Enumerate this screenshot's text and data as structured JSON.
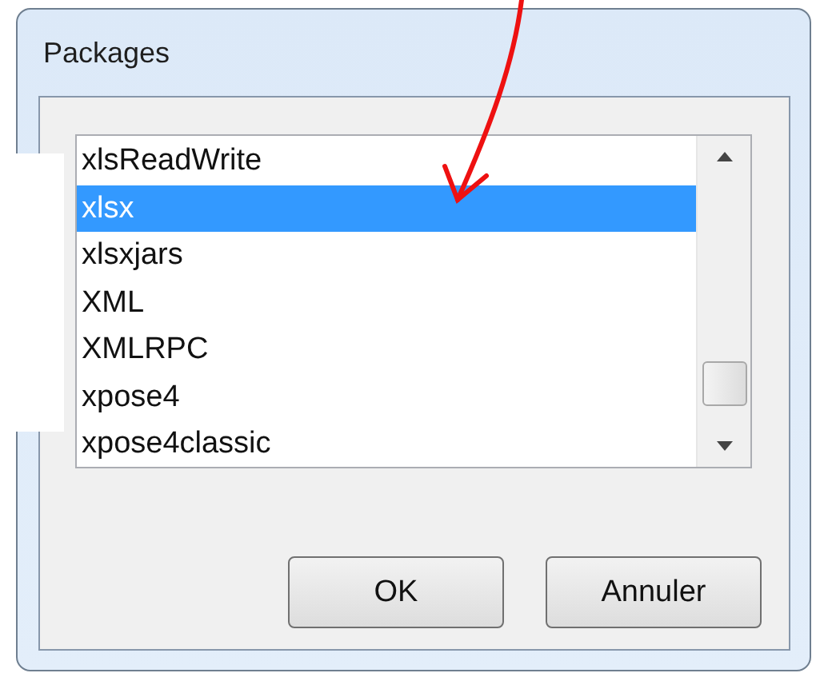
{
  "window": {
    "title": "Packages"
  },
  "packages": [
    {
      "label": "xlsReadWrite",
      "selected": false
    },
    {
      "label": "xlsx",
      "selected": true
    },
    {
      "label": "xlsxjars",
      "selected": false
    },
    {
      "label": "XML",
      "selected": false
    },
    {
      "label": "XMLRPC",
      "selected": false
    },
    {
      "label": "xpose4",
      "selected": false
    },
    {
      "label": "xpose4classic",
      "selected": false
    }
  ],
  "buttons": [
    "OK",
    "Annuler"
  ]
}
